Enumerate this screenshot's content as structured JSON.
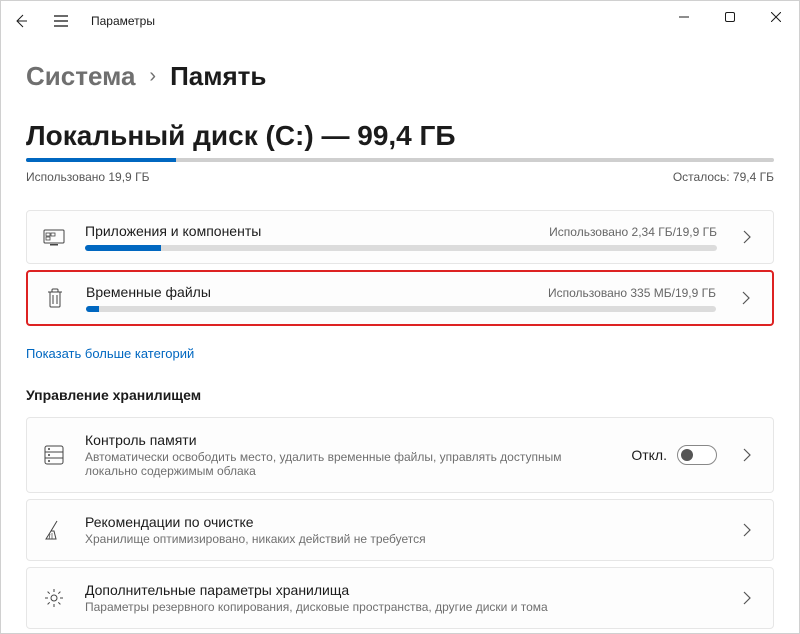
{
  "window": {
    "title": "Параметры"
  },
  "breadcrumb": {
    "root": "Система",
    "current": "Память"
  },
  "disk": {
    "title": "Локальный диск (C:) — 99,4 ГБ",
    "used_pct": 20,
    "used_label": "Использовано 19,9 ГБ",
    "free_label": "Осталось: 79,4 ГБ"
  },
  "categories": [
    {
      "title": "Приложения и компоненты",
      "usage": "Использовано 2,34 ГБ/19,9 ГБ",
      "pct": 12,
      "highlight": false,
      "icon": "apps"
    },
    {
      "title": "Временные файлы",
      "usage": "Использовано 335 МБ/19,9 ГБ",
      "pct": 2,
      "highlight": true,
      "icon": "trash"
    }
  ],
  "show_more": "Показать больше категорий",
  "storage_mgmt": {
    "heading": "Управление хранилищем",
    "items": [
      {
        "title": "Контроль памяти",
        "desc": "Автоматически освободить место, удалить временные файлы, управлять доступным локально содержимым облака",
        "toggle_label": "Откл.",
        "toggle_on": false,
        "icon": "storage"
      },
      {
        "title": "Рекомендации по очистке",
        "desc": "Хранилище оптимизировано, никаких действий не требуется",
        "icon": "broom"
      },
      {
        "title": "Дополнительные параметры хранилища",
        "desc": "Параметры резервного копирования, дисковые пространства, другие диски и тома",
        "icon": "gear"
      }
    ]
  }
}
